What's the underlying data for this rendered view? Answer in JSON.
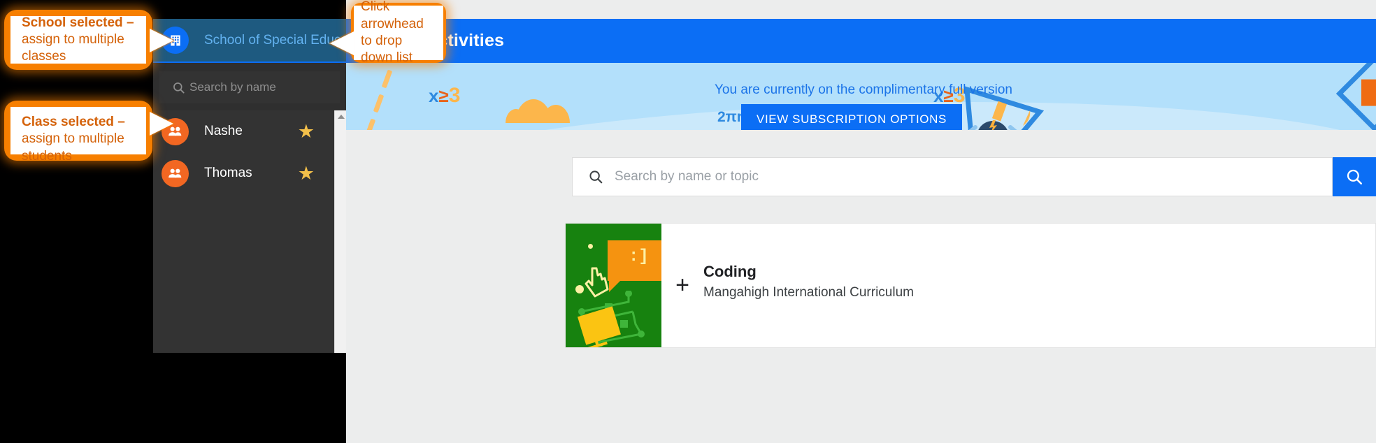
{
  "window": {
    "background_color": "#000000",
    "app_background": "#eceded"
  },
  "appbar": {
    "title": "Activities",
    "color": "#0b6ef5"
  },
  "school_selector": {
    "icon": "school-building-icon",
    "name": "School of Special Educ…",
    "caret": "caret-up-icon",
    "selected": true,
    "highlight_color": "#1e5a80",
    "text_color": "#63b2f0"
  },
  "dropdown": {
    "search": {
      "icon": "search-icon",
      "placeholder": "Search by name",
      "value": ""
    },
    "items": [
      {
        "avatar_icon": "group-people-icon",
        "name": "Nashe",
        "star": "★",
        "starred": true
      },
      {
        "avatar_icon": "group-people-icon",
        "name": "Thomas",
        "star": "★",
        "starred": true
      }
    ],
    "scrollbar": {
      "up_arrow": "scroll-up-arrow-icon"
    },
    "background_color": "#2f2f2f",
    "avatar_color": "#f26722",
    "star_color": "#f3c04a"
  },
  "banner": {
    "notice_text": "You are currently on the complimentary full version",
    "notice_color": "#1a73e8",
    "subscription_button": "VIEW SUBSCRIPTION OPTIONS",
    "button_color": "#0b6ef5",
    "background_color": "#b3e0fb",
    "decorations": [
      {
        "name": "inequality-left",
        "x": "x",
        "op": "≥",
        "num": "3"
      },
      {
        "name": "inequality-right",
        "x": "x",
        "op": "≥",
        "num": "3"
      },
      {
        "name": "two-pi-r",
        "text": "2πr"
      }
    ]
  },
  "search": {
    "icon": "search-icon",
    "placeholder": "Search by name or topic",
    "value": "",
    "submit_icon": "search-icon",
    "submit_color": "#0b6ef5"
  },
  "activity_card": {
    "thumbnail": {
      "name": "coding-thumbnail",
      "background_color": "#17820f",
      "speech_bubble_face": ":]"
    },
    "add_button": "+",
    "title": "Coding",
    "subtitle": "Mangahigh International Curriculum"
  },
  "annotations": [
    {
      "name": "callout-school-selected",
      "bold": "School selected –",
      "rest": "assign to multiple classes",
      "color": "#f77f00"
    },
    {
      "name": "callout-class-selected",
      "bold": "Class selected –",
      "rest": " assign to multiple students",
      "color": "#f77f00"
    },
    {
      "name": "callout-click-arrowhead",
      "line1": "Click arrowhead",
      "line2": "to drop down list",
      "color": "#f77f00"
    }
  ]
}
